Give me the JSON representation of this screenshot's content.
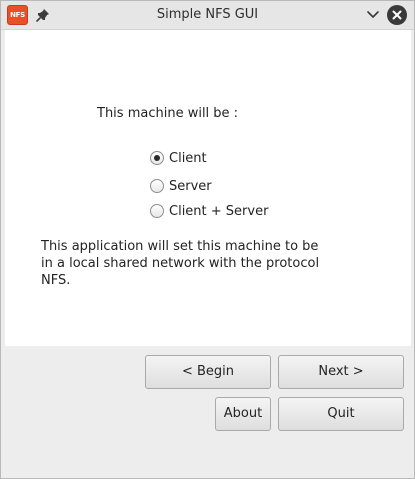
{
  "window": {
    "title": "Simple NFS GUI",
    "app_icon_text": "NFS",
    "icons": {
      "app": "nfs-app-icon",
      "pin": "pin-icon",
      "minimize": "chevron-down-icon",
      "close": "close-icon"
    }
  },
  "content": {
    "prompt": "This machine will be :",
    "options": [
      {
        "label": "Client",
        "selected": true
      },
      {
        "label": "Server",
        "selected": false
      },
      {
        "label": "Client + Server",
        "selected": false
      }
    ],
    "description": "This application will set this machine to be in a local shared network with the protocol NFS."
  },
  "buttons": {
    "begin": "< Begin",
    "next": "Next >",
    "about": "About",
    "quit": "Quit"
  },
  "colors": {
    "app_icon": "#e8502a",
    "close_button": "#3a3a3a",
    "window_bg": "#ededed",
    "content_bg": "#ffffff"
  }
}
